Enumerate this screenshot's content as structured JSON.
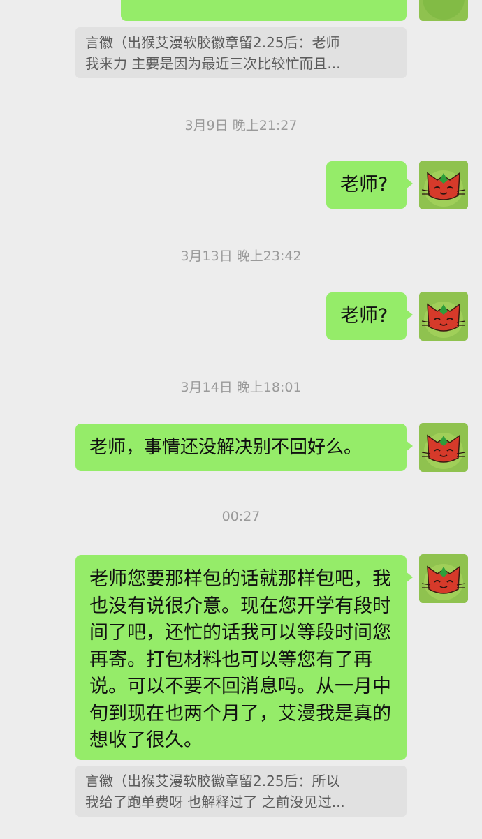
{
  "messages": {
    "quote1": {
      "line1": "言徽（出猴艾漫软胶徽章留2.25后：老师",
      "line2": "我来力 主要是因为最近三次比较忙而且..."
    },
    "ts1": "3月9日 晚上21:27",
    "msg1": "老师?",
    "ts2": "3月13日 晚上23:42",
    "msg2": "老师?",
    "ts3": "3月14日 晚上18:01",
    "msg3": "老师，事情还没解决别不回好么。",
    "ts4": "00:27",
    "msg4": "老师您要那样包的话就那样包吧，我也没有说很介意。现在您开学有段时间了吧，还忙的话我可以等段时间您再寄。打包材料也可以等您有了再说。可以不要不回消息吗。从一月中旬到现在也两个月了，艾漫我是真的想收了很久。",
    "quote2": {
      "line1": "言徽（出猴艾漫软胶徽章留2.25后：所以",
      "line2": "我给了跑单费呀 也解释过了 之前没见过..."
    }
  },
  "colors": {
    "background": "#ededed",
    "bubble": "#95ec69",
    "quote": "#e1e1e1"
  },
  "avatar_icon": "red-cat-avatar-icon"
}
